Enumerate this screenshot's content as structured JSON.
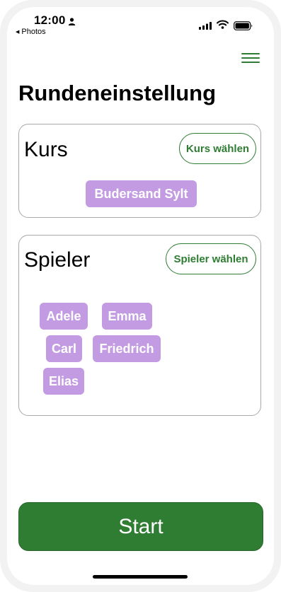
{
  "status_bar": {
    "time": "12:00",
    "back_label": "Photos",
    "icons": [
      "person-icon",
      "signal-icon",
      "wifi-icon",
      "battery-icon"
    ]
  },
  "header": {
    "menu_icon": "hamburger-menu-icon",
    "title": "Rundeneinstellung"
  },
  "course_section": {
    "heading": "Kurs",
    "select_button": "Kurs wählen",
    "selected_course": "Budersand Sylt"
  },
  "players_section": {
    "heading": "Spieler",
    "select_button": "Spieler wählen",
    "players": [
      "Adele",
      "Emma",
      "Carl",
      "Friedrich",
      "Elias"
    ]
  },
  "footer": {
    "start_button": "Start"
  },
  "colors": {
    "accent_green": "#2e7d32",
    "chip_purple": "#c39be2",
    "card_border": "#a8a8a8"
  }
}
